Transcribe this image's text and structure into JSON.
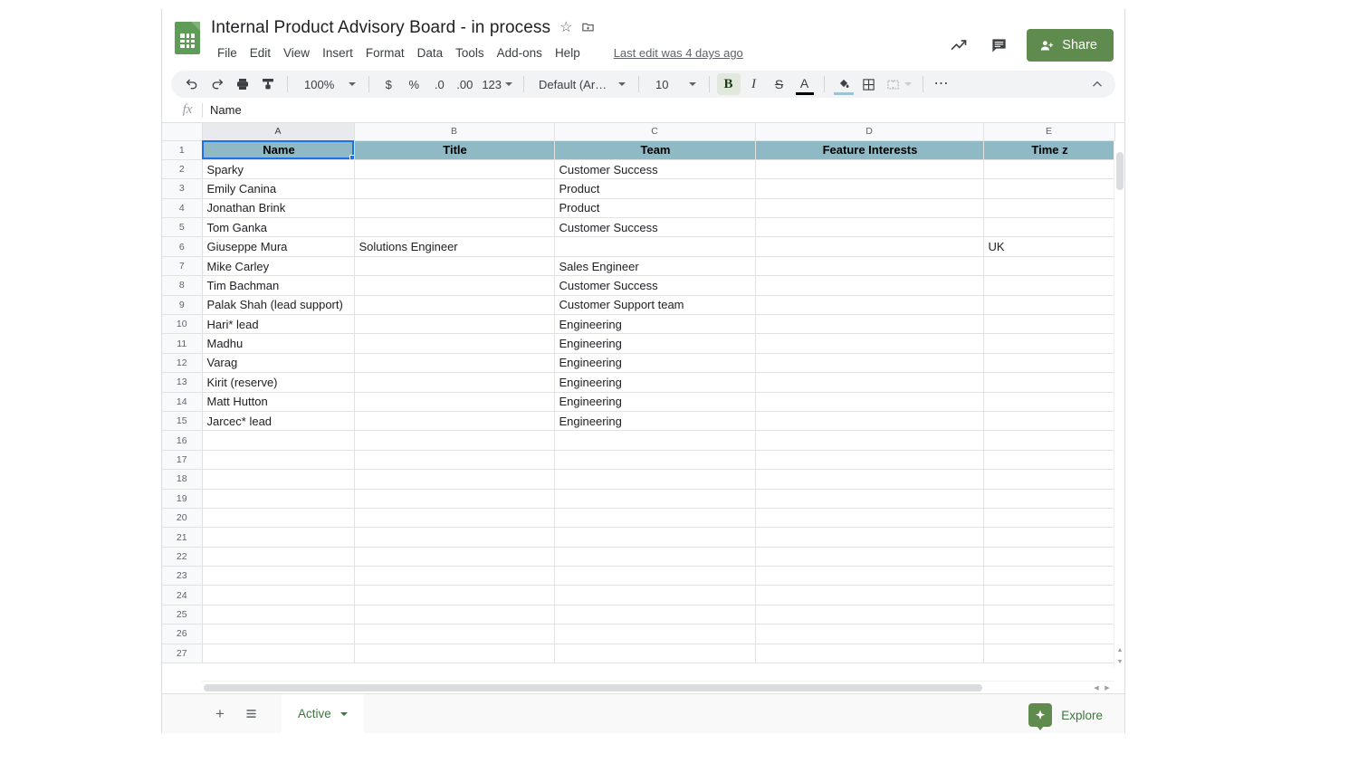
{
  "app": {
    "product": "Google Sheets",
    "logo_icon": "sheets-document-icon"
  },
  "titlebar": {
    "doc_title": "Internal Product Advisory Board - in process",
    "star_icon": "star-outline-icon",
    "move_icon": "move-to-folder-icon",
    "last_edit": "Last edit was 4 days ago",
    "activity_icon": "activity-trend-icon",
    "comments_icon": "comment-icon",
    "share_icon": "person-add-icon",
    "share_label": "Share"
  },
  "menubar": {
    "items": [
      {
        "label": "File"
      },
      {
        "label": "Edit"
      },
      {
        "label": "View"
      },
      {
        "label": "Insert"
      },
      {
        "label": "Format"
      },
      {
        "label": "Data"
      },
      {
        "label": "Tools"
      },
      {
        "label": "Add-ons"
      },
      {
        "label": "Help"
      }
    ]
  },
  "toolbar": {
    "undo_icon": "undo-icon",
    "redo_icon": "redo-icon",
    "print_icon": "print-icon",
    "paint_format_icon": "paint-format-icon",
    "zoom_value": "100%",
    "currency_icon": "$",
    "percent_icon": "%",
    "decrease_decimal_icon": ".0",
    "increase_decimal_icon": ".00",
    "number_format_label": "123",
    "font_family": "Default (Ari…",
    "font_size": "10",
    "bold_icon": "B",
    "bold_active": true,
    "italic_icon": "I",
    "strikethrough_icon": "S",
    "text_color_icon": "A",
    "fill_color_icon": "fill-color-icon",
    "borders_icon": "borders-icon",
    "merge_cells_icon": "merge-cells-icon",
    "more_icon": "more-options-icon",
    "collapse_icon": "chevron-up-icon"
  },
  "formula_bar": {
    "fx_icon": "fx-icon",
    "value": "Name",
    "placeholder": ""
  },
  "grid": {
    "column_headers": [
      "A",
      "B",
      "C",
      "D",
      "E"
    ],
    "selected_column": "A",
    "selected_cell": "A1",
    "header_fill_color": "#8fb9c5",
    "selection_border_color": "#1a73e8",
    "rows": [
      {
        "num": "1",
        "header": true,
        "cells": [
          "Name",
          "Title",
          "Team",
          "Feature Interests",
          "Time z"
        ]
      },
      {
        "num": "2",
        "header": false,
        "cells": [
          "Sparky",
          "",
          "Customer Success",
          "",
          ""
        ]
      },
      {
        "num": "3",
        "header": false,
        "cells": [
          "Emily Canina",
          "",
          "Product",
          "",
          ""
        ]
      },
      {
        "num": "4",
        "header": false,
        "cells": [
          "Jonathan Brink",
          "",
          "Product",
          "",
          ""
        ]
      },
      {
        "num": "5",
        "header": false,
        "cells": [
          "Tom Ganka",
          "",
          "Customer Success",
          "",
          ""
        ]
      },
      {
        "num": "6",
        "header": false,
        "cells": [
          "Giuseppe Mura",
          "Solutions Engineer",
          "",
          "",
          "UK"
        ]
      },
      {
        "num": "7",
        "header": false,
        "cells": [
          "Mike Carley",
          "",
          "Sales Engineer",
          "",
          ""
        ]
      },
      {
        "num": "8",
        "header": false,
        "cells": [
          "Tim Bachman",
          "",
          "Customer Success",
          "",
          ""
        ]
      },
      {
        "num": "9",
        "header": false,
        "cells": [
          "Palak Shah (lead support)",
          "",
          "Customer Support team",
          "",
          ""
        ]
      },
      {
        "num": "10",
        "header": false,
        "cells": [
          "Hari* lead",
          "",
          "Engineering",
          "",
          ""
        ]
      },
      {
        "num": "11",
        "header": false,
        "cells": [
          "Madhu",
          "",
          "Engineering",
          "",
          ""
        ]
      },
      {
        "num": "12",
        "header": false,
        "cells": [
          "Varag",
          "",
          "Engineering",
          "",
          ""
        ]
      },
      {
        "num": "13",
        "header": false,
        "cells": [
          "Kirit (reserve)",
          "",
          "Engineering",
          "",
          ""
        ]
      },
      {
        "num": "14",
        "header": false,
        "cells": [
          "Matt Hutton",
          "",
          "Engineering",
          "",
          ""
        ]
      },
      {
        "num": "15",
        "header": false,
        "cells": [
          "Jarcec* lead",
          "",
          "Engineering",
          "",
          ""
        ]
      },
      {
        "num": "16",
        "header": false,
        "cells": [
          "",
          "",
          "",
          "",
          ""
        ]
      },
      {
        "num": "17",
        "header": false,
        "cells": [
          "",
          "",
          "",
          "",
          ""
        ]
      },
      {
        "num": "18",
        "header": false,
        "cells": [
          "",
          "",
          "",
          "",
          ""
        ]
      },
      {
        "num": "19",
        "header": false,
        "cells": [
          "",
          "",
          "",
          "",
          ""
        ]
      },
      {
        "num": "20",
        "header": false,
        "cells": [
          "",
          "",
          "",
          "",
          ""
        ]
      },
      {
        "num": "21",
        "header": false,
        "cells": [
          "",
          "",
          "",
          "",
          ""
        ]
      },
      {
        "num": "22",
        "header": false,
        "cells": [
          "",
          "",
          "",
          "",
          ""
        ]
      },
      {
        "num": "23",
        "header": false,
        "cells": [
          "",
          "",
          "",
          "",
          ""
        ]
      },
      {
        "num": "24",
        "header": false,
        "cells": [
          "",
          "",
          "",
          "",
          ""
        ]
      },
      {
        "num": "25",
        "header": false,
        "cells": [
          "",
          "",
          "",
          "",
          ""
        ]
      },
      {
        "num": "26",
        "header": false,
        "cells": [
          "",
          "",
          "",
          "",
          ""
        ]
      },
      {
        "num": "27",
        "header": false,
        "cells": [
          "",
          "",
          "",
          "",
          ""
        ]
      }
    ]
  },
  "bottombar": {
    "add_sheet_icon": "add-sheet-icon",
    "all_sheets_icon": "all-sheets-list-icon",
    "active_tab_label": "Active",
    "tab_caret_icon": "chevron-down-icon",
    "explore_icon": "explore-icon",
    "explore_label": "Explore"
  }
}
